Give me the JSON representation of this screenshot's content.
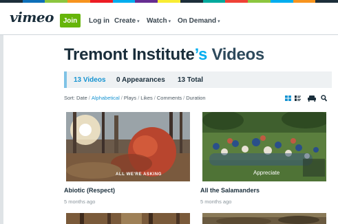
{
  "brand": {
    "logo": "vimeo",
    "stripe_colors": [
      "#1d2e3a",
      "#0d6fb8",
      "#8cc63f",
      "#f7941e",
      "#ed1c24",
      "#00adef",
      "#662d91",
      "#f9ed32",
      "#1d2e3a",
      "#00a99d",
      "#ef4136",
      "#8cc63f",
      "#00adef",
      "#f7941e",
      "#1d2e3a"
    ]
  },
  "nav": {
    "join": "Join",
    "login": "Log in",
    "items": [
      {
        "label": "Create"
      },
      {
        "label": "Watch"
      },
      {
        "label": "On Demand"
      }
    ]
  },
  "page": {
    "owner": "Tremont Institute",
    "apostrophe": "’s",
    "suffix": " Videos"
  },
  "tabs": [
    {
      "label": "13 Videos",
      "active": true
    },
    {
      "label": "0 Appearances",
      "active": false
    },
    {
      "label": "13 Total",
      "active": false
    }
  ],
  "sort": {
    "prefix": "Sort:",
    "options": [
      "Date",
      "Alphabetical",
      "Plays",
      "Likes",
      "Comments",
      "Duration"
    ],
    "selected": "Alphabetical"
  },
  "view_icons": [
    "grid-view-icon",
    "list-view-icon",
    "couch-mode-icon",
    "search-icon"
  ],
  "videos": [
    {
      "title": "Abiotic (Respect)",
      "meta": "5 months ago",
      "overlay": "ALL WE'RE ASKING"
    },
    {
      "title": "All the Salamanders",
      "meta": "5 months ago",
      "overlay": "Appreciate"
    }
  ],
  "colors": {
    "accent": "#1593d1",
    "join": "#66b50a",
    "text": "#1a2e3b"
  }
}
